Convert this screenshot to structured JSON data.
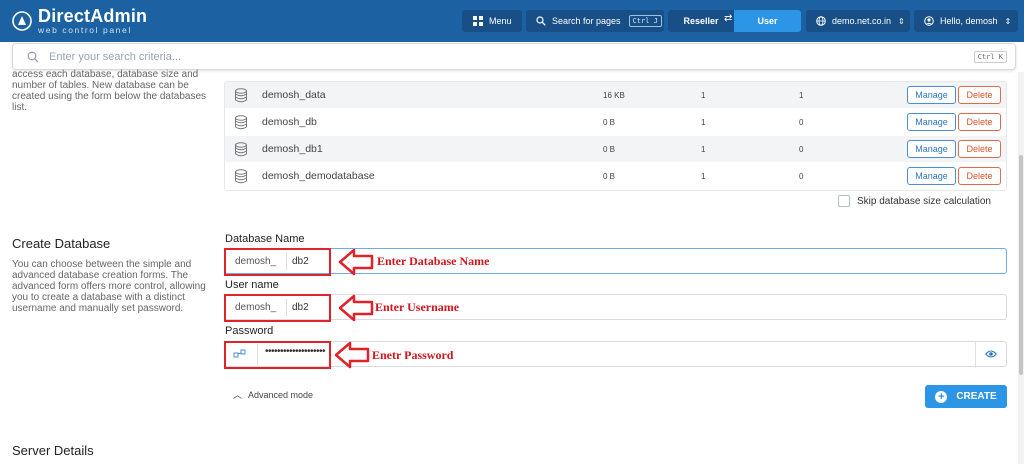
{
  "header": {
    "brand": "DirectAdmin",
    "brand_sub": "web control panel",
    "menu_label": "Menu",
    "search_pages_label": "Search for pages",
    "search_pages_shortcut": "Ctrl J",
    "role_reseller": "Reseller",
    "role_user": "User",
    "domain": "demo.net.co.in",
    "greeting": "Hello, demosh",
    "colors": {
      "bar": "#1c62a3",
      "active": "#2d95e6"
    }
  },
  "search": {
    "placeholder": "Enter your search criteria...",
    "shortcut": "Ctrl K"
  },
  "databases_intro": {
    "text": "access each database, database size and number of tables. New database can be created using the form below the databases list."
  },
  "databases": [
    {
      "name": "demosh_data",
      "size": "16 KB",
      "users": "1",
      "tables": "1"
    },
    {
      "name": "demosh_db",
      "size": "0 B",
      "users": "1",
      "tables": "0"
    },
    {
      "name": "demosh_db1",
      "size": "0 B",
      "users": "1",
      "tables": "0"
    },
    {
      "name": "demosh_demodatabase",
      "size": "0 B",
      "users": "1",
      "tables": "0"
    }
  ],
  "row_actions": {
    "manage": "Manage",
    "delete": "Delete"
  },
  "skip_label": "Skip database size calculation",
  "create": {
    "title": "Create Database",
    "description": "You can choose between the simple and advanced database creation forms. The advanced form offers more control, allowing you to create a database with a distinct username and manually set password.",
    "db_name_label": "Database Name",
    "db_name_prefix": "demosh_",
    "db_name_value": "db2",
    "username_label": "User name",
    "username_prefix": "demosh_",
    "username_value": "db2",
    "password_label": "Password",
    "password_value": "••••••••••••••••••••",
    "advanced_label": "Advanced mode",
    "create_label": "CREATE"
  },
  "annotations": {
    "db_name": "Enter Database Name",
    "username": "Enter Username",
    "password": "Enetr Password",
    "color": "#e0222a"
  },
  "server_details_title": "Server Details"
}
